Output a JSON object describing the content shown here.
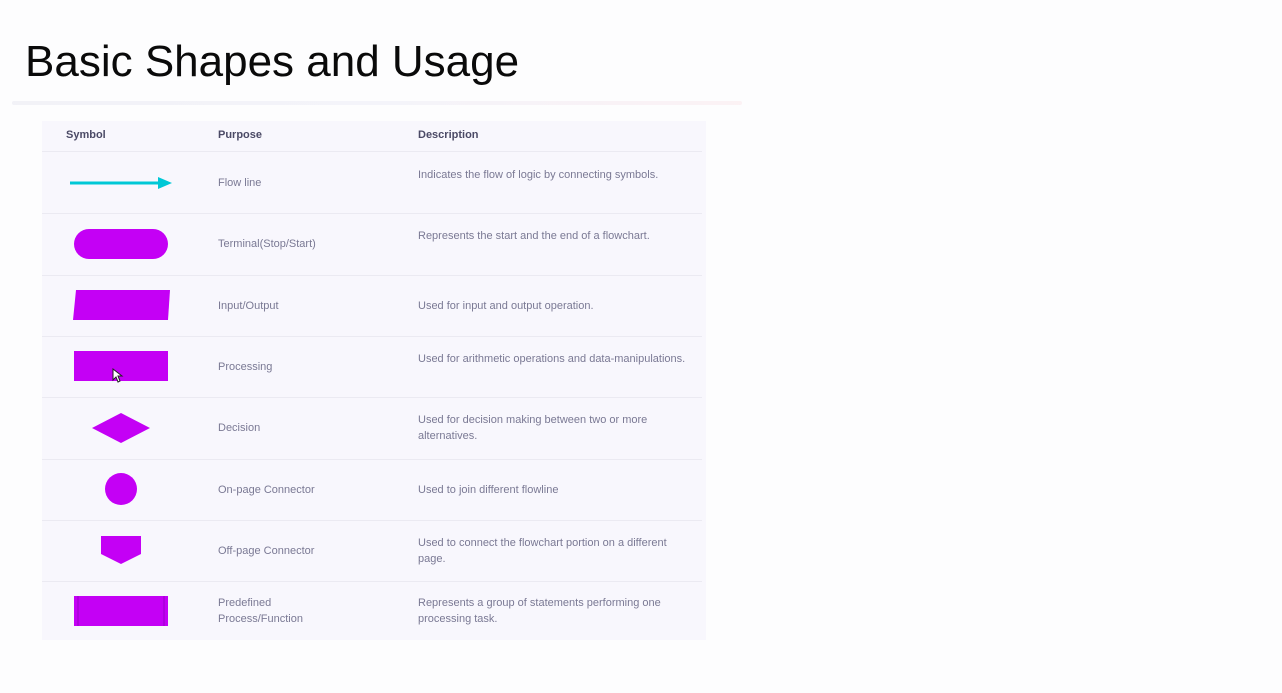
{
  "slide": {
    "title": "Basic Shapes and Usage"
  },
  "table": {
    "headers": {
      "symbol": "Symbol",
      "purpose": "Purpose",
      "description": "Description"
    },
    "rows": [
      {
        "shape": "arrow",
        "purpose": "Flow line",
        "description": "Indicates the flow of logic by connecting symbols."
      },
      {
        "shape": "terminal",
        "purpose": "Terminal(Stop/Start)",
        "description": "Represents the start and the end of a flowchart."
      },
      {
        "shape": "parallelogram",
        "purpose": "Input/Output",
        "description": "Used for input and output operation."
      },
      {
        "shape": "rectangle",
        "purpose": "Processing",
        "description": "Used for arithmetic operations and data-manipulations."
      },
      {
        "shape": "diamond",
        "purpose": "Decision",
        "description": "Used for decision making between two or more alternatives."
      },
      {
        "shape": "circle",
        "purpose": "On-page Connector",
        "description": "Used to join different flowline"
      },
      {
        "shape": "pentagon",
        "purpose": "Off-page Connector",
        "description": "Used to connect the flowchart portion on a different page."
      },
      {
        "shape": "predefined-process",
        "purpose": "Predefined Process/Function",
        "description": "Represents a group of statements performing one processing task."
      }
    ]
  },
  "colors": {
    "shape_fill": "#c400f5",
    "flow_line": "#00c8d6",
    "title": "#0a0a0a"
  }
}
